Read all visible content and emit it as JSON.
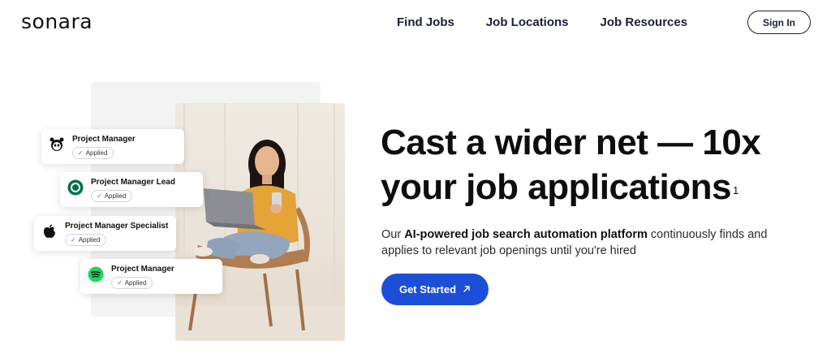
{
  "header": {
    "logo_text": "sonara",
    "nav": [
      "Find Jobs",
      "Job Locations",
      "Job Resources"
    ],
    "sign_in_label": "Sign In"
  },
  "cards": [
    {
      "title": "Project Manager",
      "status": "Applied",
      "icon": "panda-icon"
    },
    {
      "title": "Project Manager Lead",
      "status": "Applied",
      "icon": "starbucks-icon"
    },
    {
      "title": "Project Manager Specialist",
      "status": "Applied",
      "icon": "apple-icon"
    },
    {
      "title": "Project Manager",
      "status": "Applied",
      "icon": "spotify-icon"
    }
  ],
  "hero": {
    "headline_line1": "Cast a wider net — 10x",
    "headline_line2": "your job applications",
    "footnote": "1",
    "sub_before": "Our ",
    "sub_bold": "AI-powered job search automation platform",
    "sub_after": " continuously finds and applies to relevant job openings until you're hired",
    "cta_label": "Get Started",
    "cta_icon": "arrow-up-right-icon"
  },
  "colors": {
    "accent": "#1d4ed8",
    "nav_text": "#1b1f3b",
    "spotify": "#1ed760",
    "starbucks": "#00704a"
  }
}
